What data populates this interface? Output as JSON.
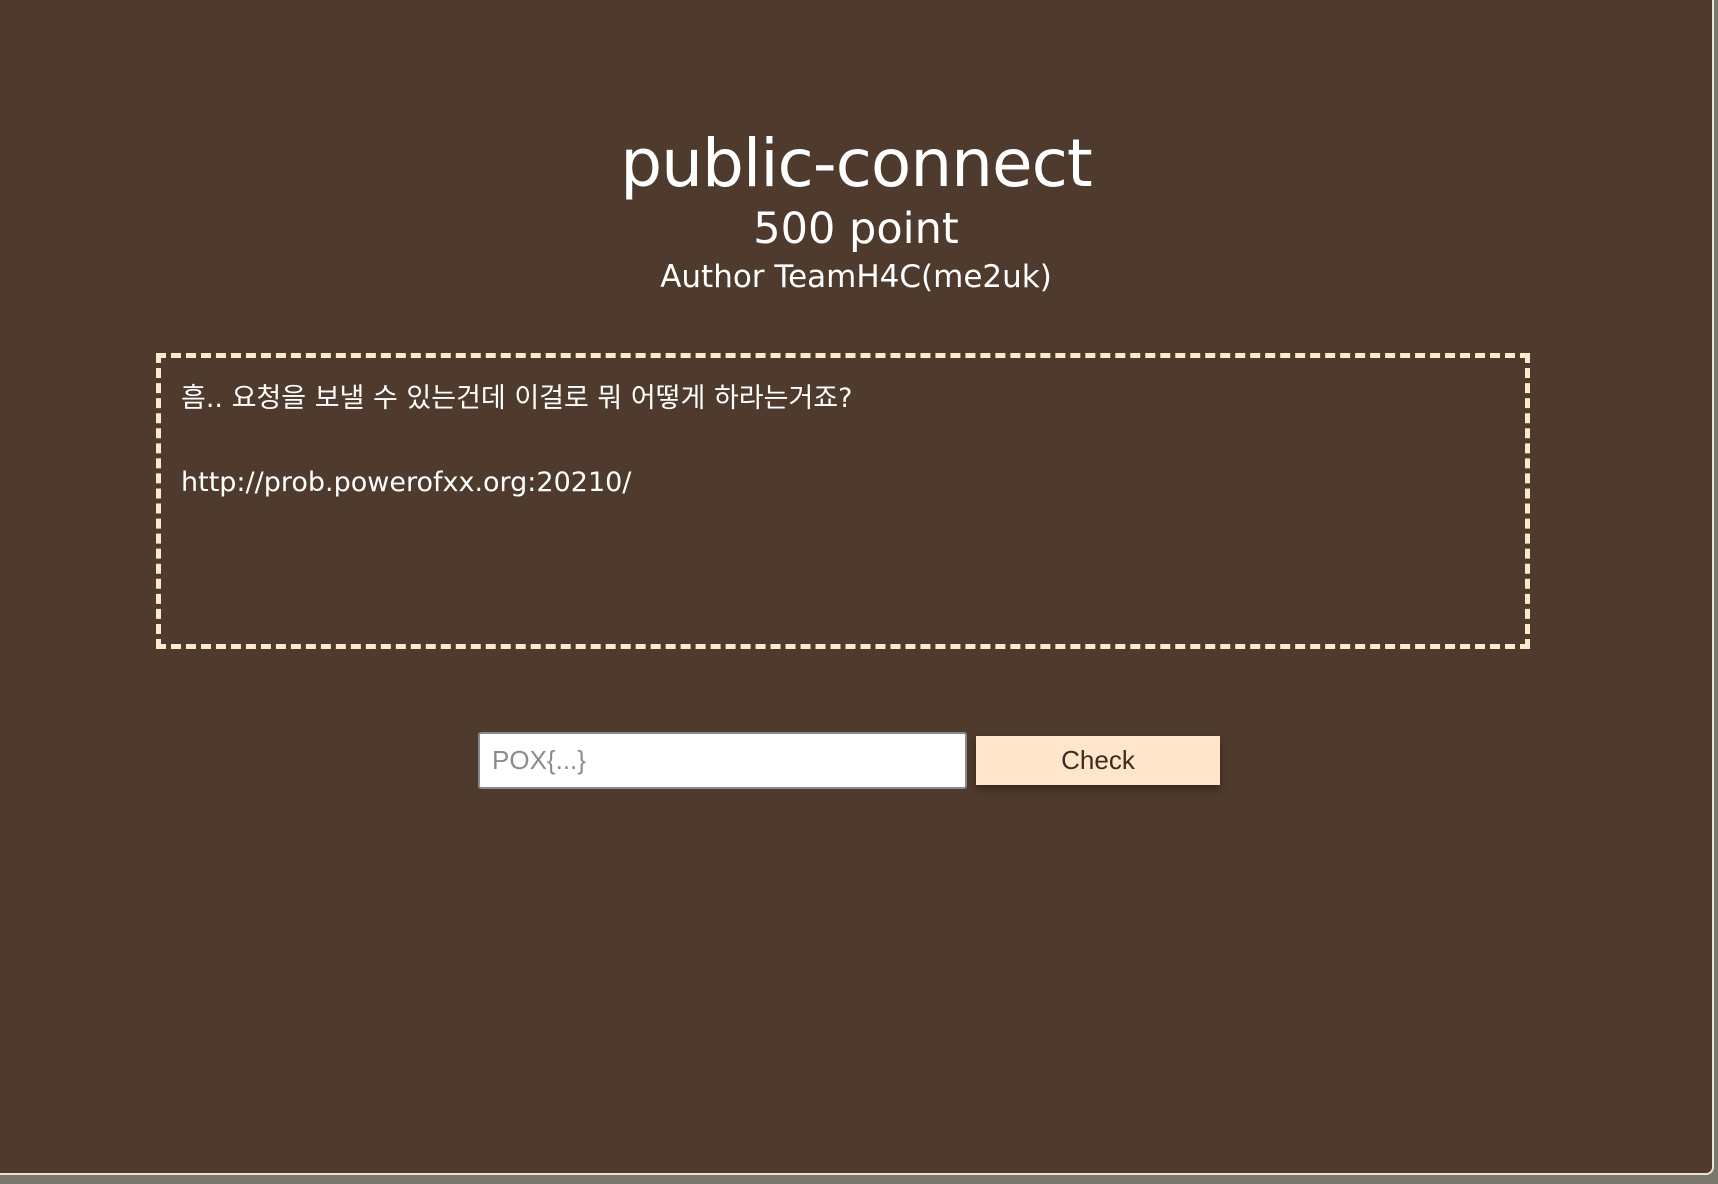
{
  "challenge": {
    "title": "public-connect",
    "points": "500 point",
    "author": "Author TeamH4C(me2uk)"
  },
  "description": {
    "line1": "흠.. 요청을 보낼 수 있는건데 이걸로 뭐 어떻게 하라는거죠?",
    "url": "http://prob.powerofxx.org:20210/"
  },
  "flag_form": {
    "input_placeholder": "POX{...}",
    "input_value": "",
    "check_label": "Check"
  },
  "colors": {
    "page_background": "#4f3b2d",
    "box_border": "#ffe9cd",
    "button_background": "#ffe5c9"
  }
}
